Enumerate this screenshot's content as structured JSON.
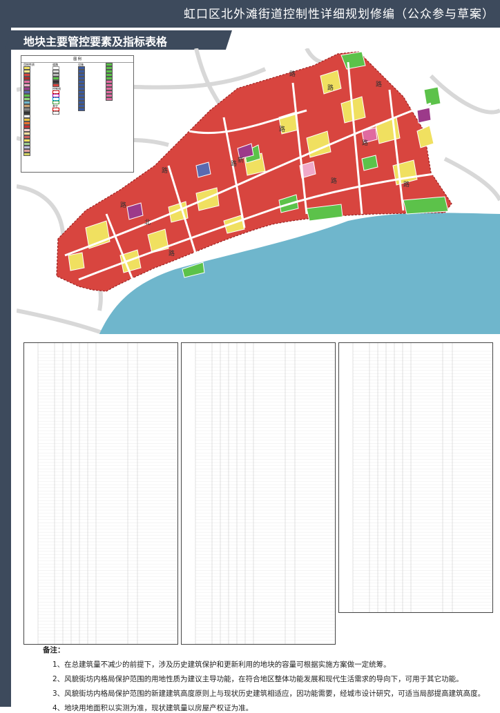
{
  "header": {
    "title": "虹口区北外滩街道控制性详细规划修编（公众参与草案）",
    "section_title": "地块主要管控要素及指标表格"
  },
  "legend": {
    "title": "图 例",
    "group_land_use": "用地性质",
    "group_road": "道路",
    "group_facility": "设施",
    "group_control": "控制线",
    "group_other": "其它"
  },
  "map": {
    "road_chars": [
      "路",
      "路",
      "路",
      "路",
      "路",
      "路",
      "路",
      "北",
      "路",
      "路",
      "新",
      "路",
      "路"
    ]
  },
  "notes": {
    "title": "备注：",
    "items": [
      "1、在总建筑量不减少的前提下，涉及历史建筑保护和更新利用的地块的容量可根据实施方案做一定统筹。",
      "2、风貌街坊内格局保护范围的用地性质为建议主导功能，在符合地区整体功能发展和现代生活需求的导向下，可用于其它功能。",
      "3、风貌街坊内格局保护范围的新建建筑高度原则上与现状历史建筑相适应，因功能需要，经城市设计研究，可适当局部提高建筑高度。",
      "4、地块用地面积以实测为准，现状建筑量以房屋产权证为准。"
    ]
  },
  "colors": {
    "header": "#3d4a5c",
    "commercial": "#d8453f",
    "residential": "#f0e060",
    "green": "#5cc24a",
    "water": "#6fb6cc",
    "mixed": "#9c3a8a",
    "education": "#f0a8c8",
    "admin": "#e06aa0"
  }
}
